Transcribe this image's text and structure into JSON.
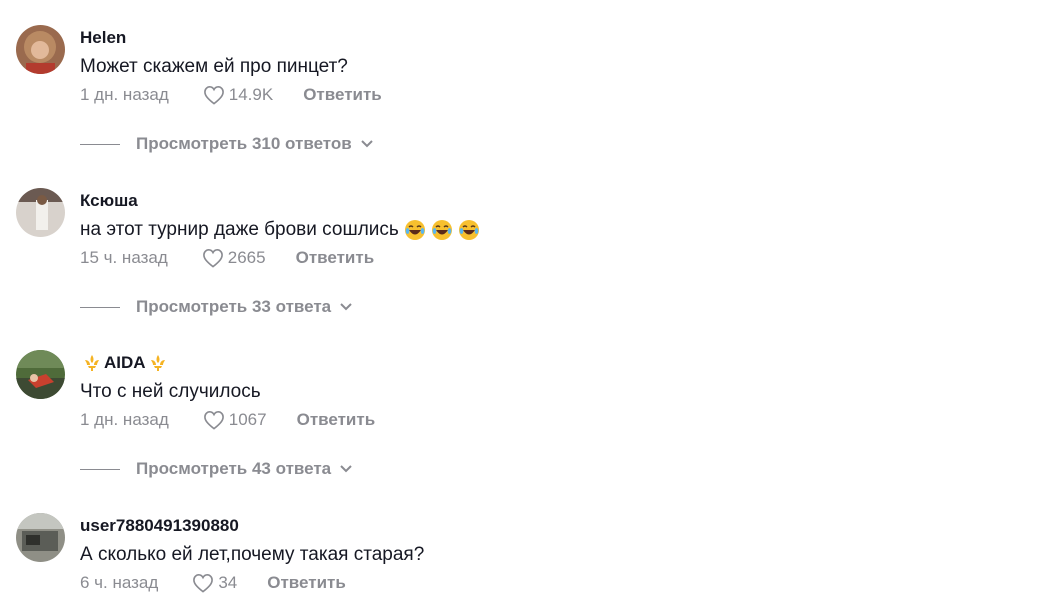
{
  "comments": [
    {
      "username": "Helen",
      "text": "Может скажем ей про пинцет?",
      "time": "1 дн. назад",
      "likes": "14.9K",
      "reply_label": "Ответить",
      "view_replies": "Просмотреть 310 ответов",
      "avatar_icon": "avatar-helen"
    },
    {
      "username": "Ксюша",
      "text": "на этот турнир даже брови сошлись",
      "emojis": [
        "laughing-emoji",
        "laughing-emoji",
        "laughing-emoji"
      ],
      "time": "15 ч. назад",
      "likes": "2665",
      "reply_label": "Ответить",
      "view_replies": "Просмотреть 33 ответа",
      "avatar_icon": "avatar-ksyusha"
    },
    {
      "username": "AIDA",
      "username_decoration": "fleur-de-lis-icon",
      "text": "Что с ней случилось",
      "time": "1 дн. назад",
      "likes": "1067",
      "reply_label": "Ответить",
      "view_replies": "Просмотреть 43 ответа",
      "avatar_icon": "avatar-aida"
    },
    {
      "username": "user7880491390880",
      "text": "А сколько ей лет,почему такая старая?",
      "time": "6 ч. назад",
      "likes": "34",
      "reply_label": "Ответить",
      "avatar_icon": "avatar-user"
    }
  ],
  "colors": {
    "text_primary": "#161823",
    "text_secondary": "#8a8b91",
    "crown": "#f5b323"
  }
}
